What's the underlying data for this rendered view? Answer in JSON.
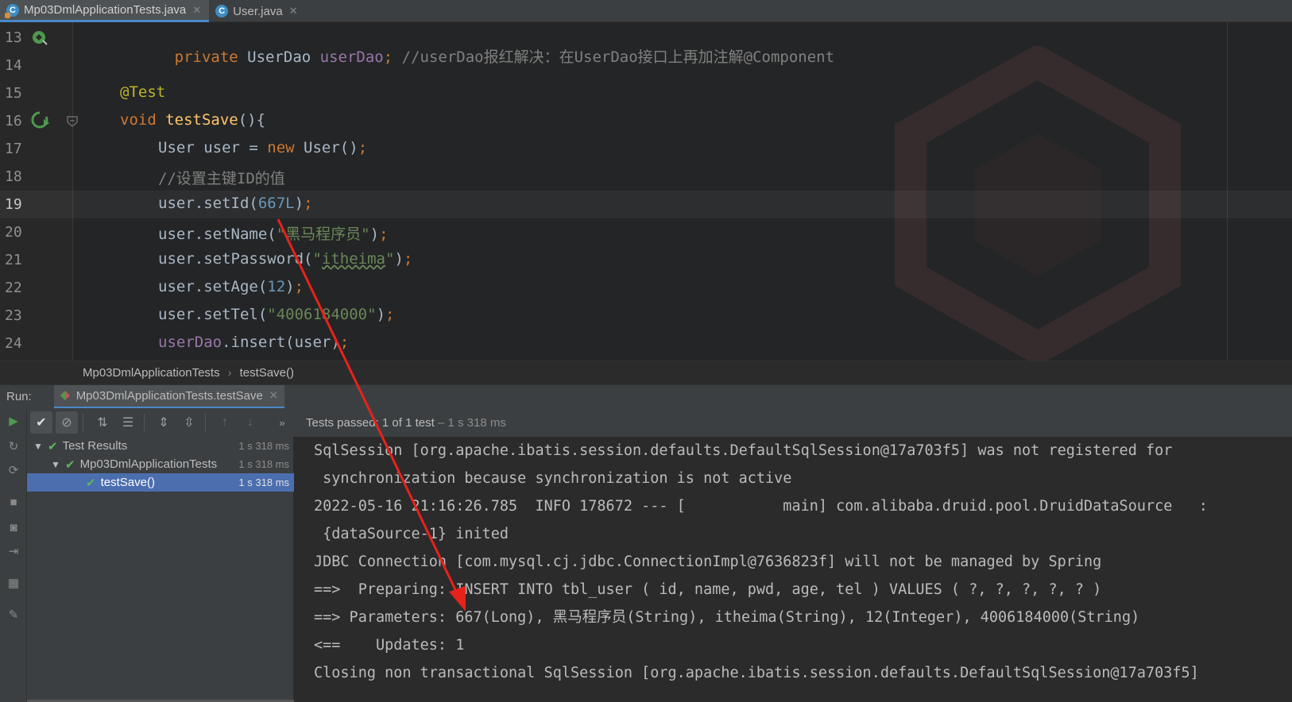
{
  "tabs": [
    {
      "label": "Mp03DmlApplicationTests.java",
      "active": true,
      "icon": "test-class-icon"
    },
    {
      "label": "User.java",
      "active": false,
      "icon": "class-icon"
    }
  ],
  "editor": {
    "lines": [
      {
        "num": "13"
      },
      {
        "num": "14"
      },
      {
        "num": "15"
      },
      {
        "num": "16"
      },
      {
        "num": "17"
      },
      {
        "num": "18"
      },
      {
        "num": "19"
      },
      {
        "num": "20"
      },
      {
        "num": "21"
      },
      {
        "num": "22"
      },
      {
        "num": "23"
      },
      {
        "num": "24"
      }
    ],
    "code": {
      "l13_kw": "private ",
      "l13_type": "UserDao ",
      "l13_field": "userDao",
      "l13_semi": "; ",
      "l13_comment": "//userDao报红解决：在UserDao接口上再加注解@Component",
      "l15_ann": "@Test",
      "l16_kw": "void ",
      "l16_fn": "testSave",
      "l16_rest": "(){",
      "l17_a": "User user = ",
      "l17_kw": "new ",
      "l17_b": "User()",
      "l17_semi": ";",
      "l18_comment": "//设置主键ID的值",
      "l19_a": "user.setId(",
      "l19_num": "667L",
      "l19_b": ")",
      "l19_semi": ";",
      "l20_a": "user.setName(",
      "l20_str": "\"黑马程序员\"",
      "l20_b": ")",
      "l20_semi": ";",
      "l21_a": "user.setPassword(",
      "l21_q1": "\"",
      "l21_str": "itheima",
      "l21_q2": "\"",
      "l21_b": ")",
      "l21_semi": ";",
      "l22_a": "user.setAge(",
      "l22_num": "12",
      "l22_b": ")",
      "l22_semi": ";",
      "l23_a": "user.setTel(",
      "l23_str": "\"4006184000\"",
      "l23_b": ")",
      "l23_semi": ";",
      "l24_field": "userDao",
      "l24_a": ".insert(user)",
      "l24_semi": ";"
    }
  },
  "breadcrumb": {
    "class": "Mp03DmlApplicationTests",
    "method": "testSave()"
  },
  "run": {
    "label": "Run:",
    "config": "Mp03DmlApplicationTests.testSave",
    "status_prefix": "Tests passed: ",
    "status_count": "1",
    "status_rest": " of 1 test",
    "status_time": " – 1 s 318 ms"
  },
  "tree": [
    {
      "name": "Test Results",
      "time": "1 s 318 ms"
    },
    {
      "name": "Mp03DmlApplicationTests",
      "time": "1 s 318 ms"
    },
    {
      "name": "testSave()",
      "time": "1 s 318 ms"
    }
  ],
  "console": [
    "SqlSession [org.apache.ibatis.session.defaults.DefaultSqlSession@17a703f5] was not registered for",
    " synchronization because synchronization is not active",
    "2022-05-16 21:16:26.785  INFO 178672 --- [           main] com.alibaba.druid.pool.DruidDataSource   :",
    " {dataSource-1} inited",
    "JDBC Connection [com.mysql.cj.jdbc.ConnectionImpl@7636823f] will not be managed by Spring",
    "==>  Preparing: INSERT INTO tbl_user ( id, name, pwd, age, tel ) VALUES ( ?, ?, ?, ?, ? )",
    "==> Parameters: 667(Long), 黑马程序员(String), itheima(String), 12(Integer), 4006184000(String)",
    "<==    Updates: 1",
    "Closing non transactional SqlSession [org.apache.ibatis.session.defaults.DefaultSqlSession@17a703f5]"
  ],
  "colors": {
    "accent": "#4a88c7",
    "pass": "#5fb35f",
    "annotation_arrow": "#e8221b"
  }
}
